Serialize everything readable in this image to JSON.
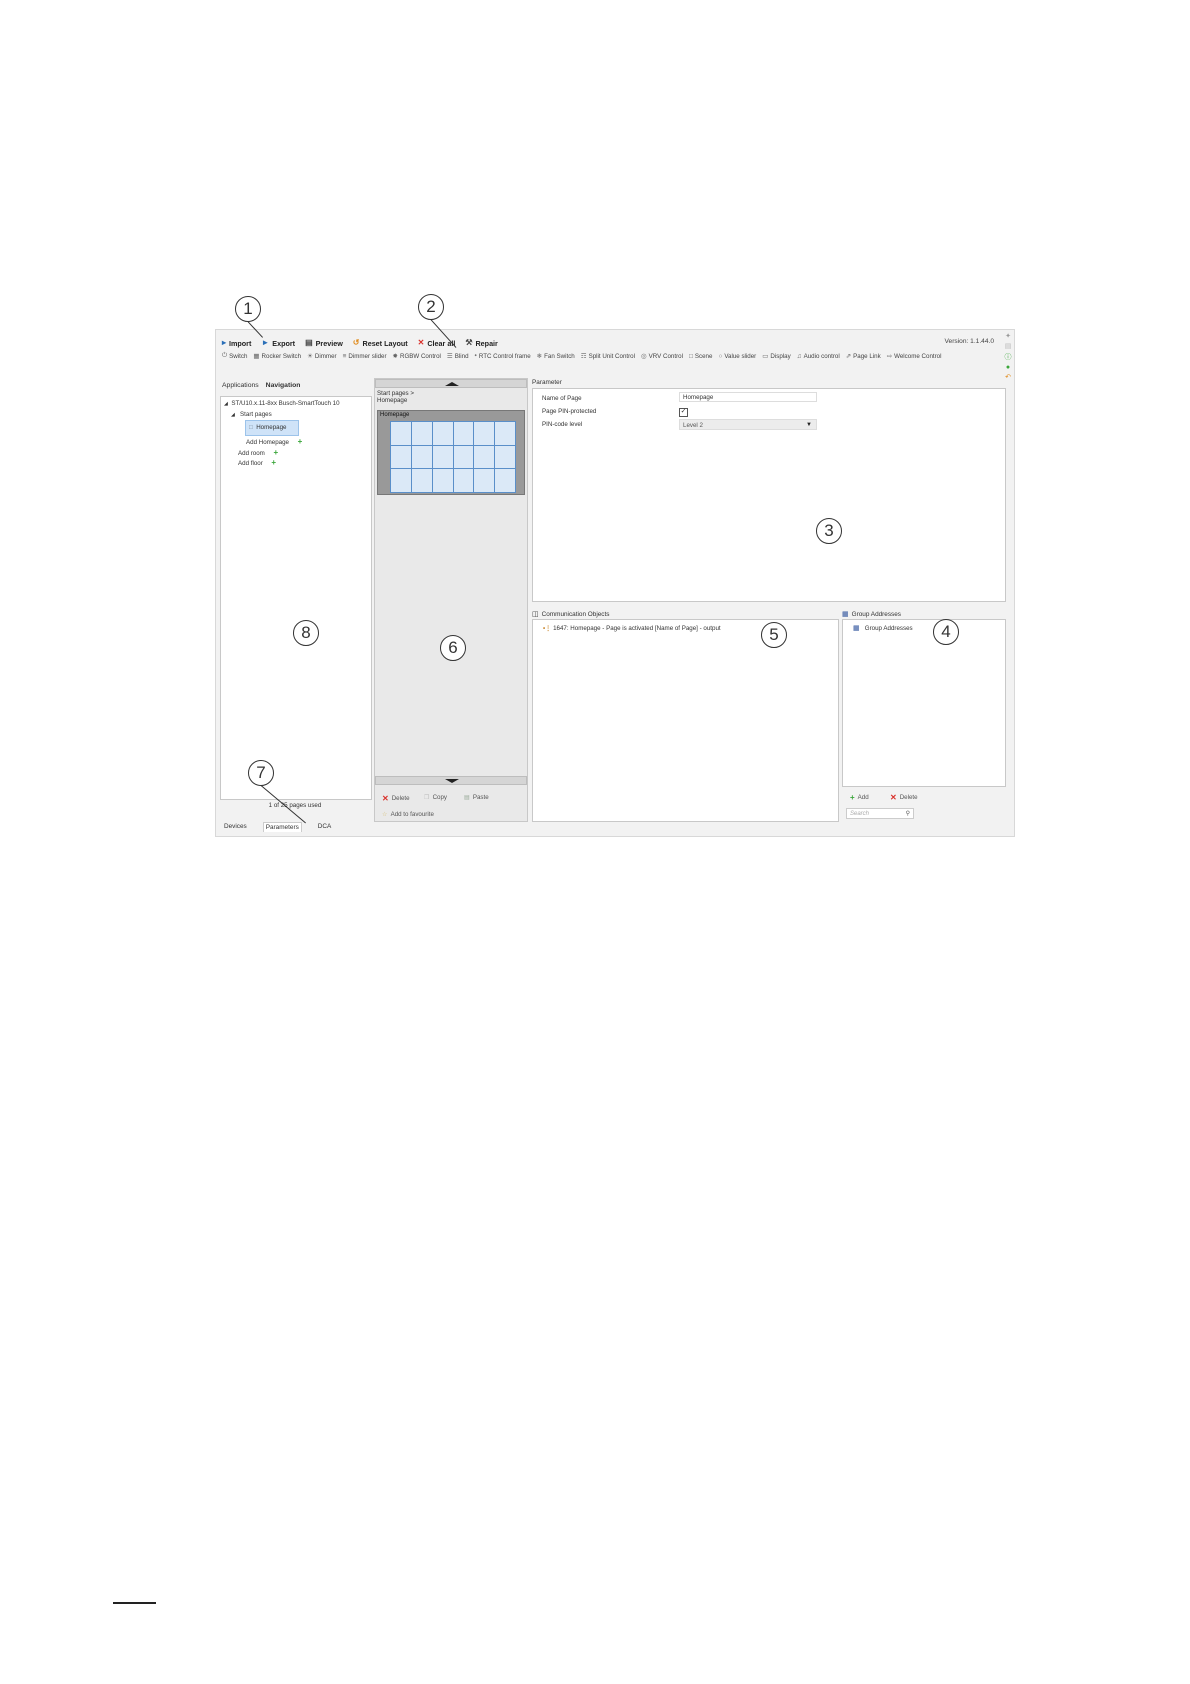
{
  "toolbar": {
    "import": "Import",
    "export": "Export",
    "preview": "Preview",
    "reset_layout": "Reset Layout",
    "clear_all": "Clear all",
    "repair": "Repair",
    "version": "Version: 1.1.44.0"
  },
  "controls": [
    "Switch",
    "Rocker Switch",
    "Dimmer",
    "Dimmer slider",
    "RGBW Control",
    "Blind",
    "RTC Control frame",
    "Fan Switch",
    "Split Unit Control",
    "VRV Control",
    "Scene",
    "Value slider",
    "Display",
    "Audio control",
    "Page Link",
    "Welcome Control"
  ],
  "left_tabs": {
    "applications": "Applications",
    "navigation": "Navigation"
  },
  "tree": {
    "device": "ST/U10.x.11-8xx Busch-SmartTouch 10",
    "start_pages": "Start pages",
    "homepage": "Homepage",
    "add_homepage": "Add Homepage",
    "add_room": "Add room",
    "add_floor": "Add floor"
  },
  "pages_used": "1 of 25 pages used",
  "bottom_tabs": {
    "devices": "Devices",
    "parameters": "Parameters",
    "dca": "DCA"
  },
  "middle": {
    "breadcrumb_line1": "Start pages >",
    "breadcrumb_line2": "Homepage",
    "thumb_label": "Homepage",
    "delete": "Delete",
    "copy": "Copy",
    "paste": "Paste",
    "add_favourite": "Add to favourite"
  },
  "parameter": {
    "header": "Parameter",
    "name_label": "Name of Page",
    "name_value": "Homepage",
    "pin_label": "Page PIN-protected",
    "pin_checked": true,
    "level_label": "PIN-code level",
    "level_value": "Level 2"
  },
  "comm": {
    "header": "Communication Objects",
    "item": "1647: Homepage - Page is activated [Name of Page] - output"
  },
  "ga": {
    "header": "Group Addresses",
    "item": "Group Addresses",
    "add": "Add",
    "delete": "Delete",
    "search_placeholder": "Search"
  },
  "callouts": {
    "c1": "1",
    "c2": "2",
    "c3": "3",
    "c4": "4",
    "c5": "5",
    "c6": "6",
    "c7": "7",
    "c8": "8"
  },
  "colors": {
    "accent": "#5a8fc9",
    "selection": "#cfe3f8",
    "delete_red": "#d9312b",
    "add_green": "#3aa63a"
  }
}
